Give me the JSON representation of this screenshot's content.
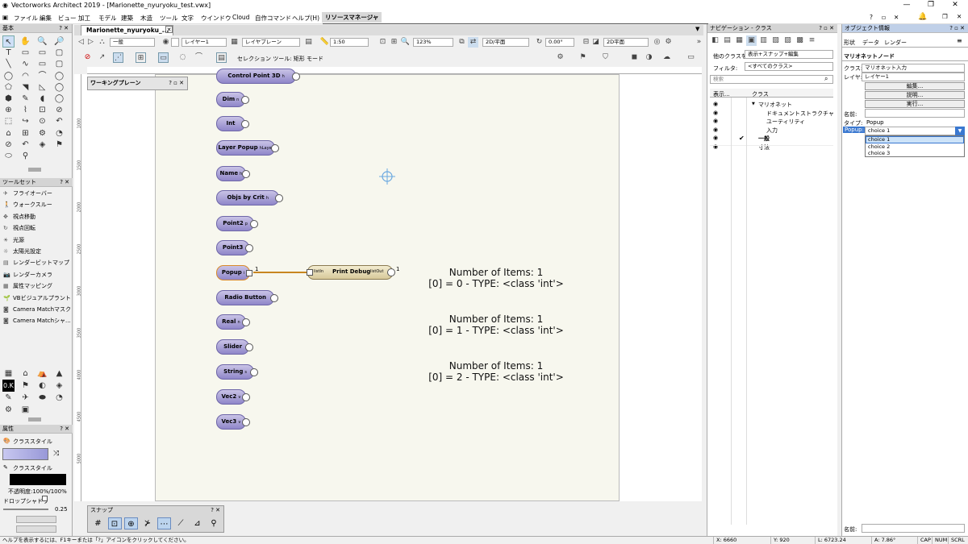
{
  "window": {
    "title": "Vectorworks Architect 2019 - [Marionette_nyuryoku_test.vwx]",
    "min": "—",
    "max": "❐",
    "close": "✕"
  },
  "menu": [
    "ファイル",
    "編集",
    "ビュー",
    "加工",
    "モデル",
    "建築",
    "木造",
    "ツール",
    "文字",
    "ウインドウ",
    "Cloud",
    "自作コマンド",
    "ヘルプ(H)"
  ],
  "resource_manager": "リソースマネージャ",
  "doc_tab": "Marionette_nyuryoku_...",
  "toolbar": {
    "class": "一般",
    "layer": "レイヤー1",
    "layer_plane": "レイヤプレーン",
    "scale": "1:50",
    "zoom": "123%",
    "view": "2D/平面",
    "angle": "0.00°",
    "render": "2D平面",
    "mode_label": "セレクション ツール: 矩形 モード"
  },
  "left": {
    "basic": "基本",
    "toolset": "ツールセット",
    "toolset_items": [
      "フライオーバー",
      "ウォークスルー",
      "視点移動",
      "視点回転",
      "光源",
      "太陽光設定",
      "レンダービットマップ",
      "レンダーカメラ",
      "属性マッピング",
      "VBビジュアルプラント",
      "Camera Matchマスク",
      "Camera Matchシャ..."
    ],
    "attr": "属性",
    "class_style": "クラススタイル",
    "class_style2": "クラススタイル",
    "opacity": "不透明度:100%/100%",
    "drop_shadow": "ドロップシャドウ",
    "line_weight": "0.25"
  },
  "working_plane": "ワーキングプレーン",
  "snap": "スナップ",
  "nodes": [
    {
      "name": "Control Point 3D",
      "port": "h"
    },
    {
      "name": "Dim",
      "port": "n"
    },
    {
      "name": "Int",
      "port": ""
    },
    {
      "name": "Layer Popup",
      "port": "hLayer"
    },
    {
      "name": "Name",
      "port": "h"
    },
    {
      "name": "Objs by Crit",
      "port": "h"
    },
    {
      "name": "Point2",
      "port": "p"
    },
    {
      "name": "Point3",
      "port": ""
    },
    {
      "name": "Popup",
      "port": "i"
    },
    {
      "name": "Radio Button",
      "port": ""
    },
    {
      "name": "Real",
      "port": "n"
    },
    {
      "name": "Slider",
      "port": ""
    },
    {
      "name": "String",
      "port": "s"
    },
    {
      "name": "Vec2",
      "port": "v"
    },
    {
      "name": "Vec3",
      "port": "v"
    }
  ],
  "popup_wire_count": "1",
  "debug_node": {
    "name": "Print Debug",
    "in": "listIn",
    "out": "listOut",
    "count": "1"
  },
  "outputs": [
    {
      "l1": "Number of Items: 1",
      "l2": "[0] = 0 - TYPE: <class 'int'>"
    },
    {
      "l1": "Number of Items: 1",
      "l2": "[0] = 1 - TYPE: <class 'int'>"
    },
    {
      "l1": "Number of Items: 1",
      "l2": "[0] = 2 - TYPE: <class 'int'>"
    }
  ],
  "rulers": {
    "left": [
      "1000",
      "1500",
      "2000",
      "2500",
      "3000",
      "3500",
      "4000",
      "4500",
      "5000"
    ]
  },
  "nav": {
    "title": "ナビゲーション - クラス",
    "other_class": "他のクラスを:",
    "other_val": "表示+スナップ+編集",
    "filter": "フィルタ:",
    "filter_val": "<すべてのクラス>",
    "search": "検索",
    "col_show": "表示...",
    "col_class": "クラス",
    "tree": [
      "マリオネット",
      "ドキュメントストラクチャ",
      "ユーティリティ",
      "入力",
      "一般",
      "寸法"
    ]
  },
  "oi": {
    "title": "オブジェクト情報",
    "tabs": [
      "形状",
      "データ",
      "レンダー"
    ],
    "node_type": "マリオネットノード",
    "class_l": "クラス:",
    "class_v": "マリオネット入力",
    "layer_l": "レイヤ:",
    "layer_v": "レイヤー1",
    "edit": "編集...",
    "desc": "説明...",
    "run": "実行...",
    "name_l": "名前:",
    "type_l": "タイプ:",
    "type_v": "Popup",
    "popup_l": "Popup:",
    "popup_v": "choice 1",
    "options": [
      "choice 1",
      "choice 2",
      "choice 3"
    ],
    "name2_l": "名前:"
  },
  "status": {
    "help": "ヘルプを表示するには、F1キーまたは「?」アイコンをクリックしてください。",
    "x": "X: 6660",
    "y": "Y: 920",
    "l": "L: 6723.24",
    "a": "A: 7.86°",
    "cap": "CAP",
    "num": "NUM",
    "scrl": "SCRL"
  }
}
